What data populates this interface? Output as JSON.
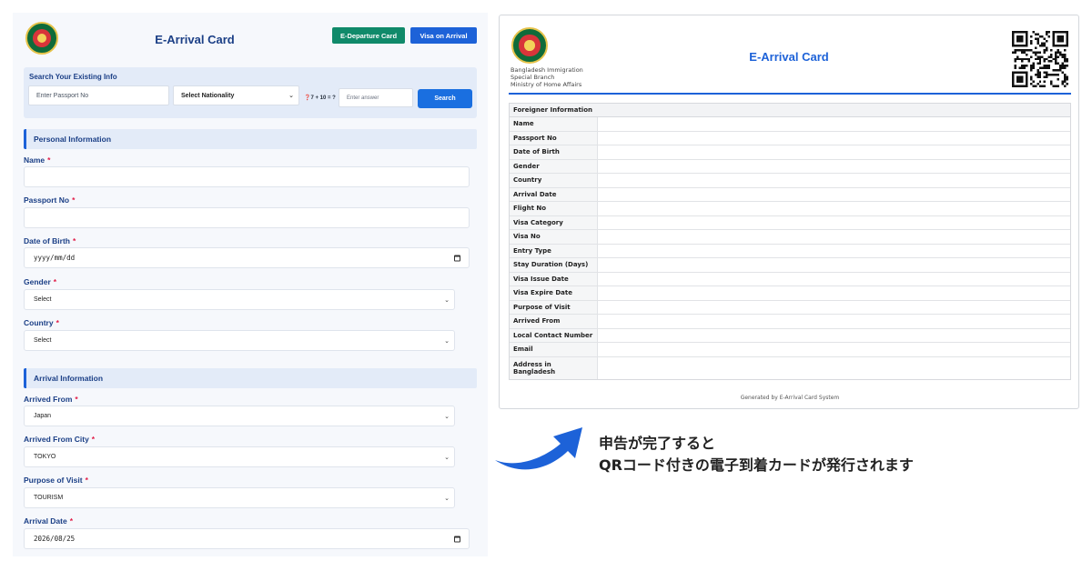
{
  "form": {
    "title": "E-Arrival Card",
    "departure_button": "E-Departure Card",
    "visa_button": "Visa on Arrival",
    "search": {
      "title": "Search Your Existing Info",
      "passport_placeholder": "Enter Passport No",
      "nationality_value": "Select Nationality",
      "captcha_question": "7 + 10 = ?",
      "answer_placeholder": "Enter answer",
      "search_button": "Search"
    },
    "personal_section": "Personal Information",
    "arrival_section": "Arrival Information",
    "required_mark": "*",
    "fields": {
      "name_label": "Name",
      "passport_label": "Passport No",
      "dob_label": "Date of Birth",
      "dob_value": "yyyy/mm/dd",
      "gender_label": "Gender",
      "gender_value": "Select",
      "country_label": "Country",
      "country_value": "Select",
      "arrived_from_label": "Arrived From",
      "arrived_from_value": "Japan",
      "arrived_city_label": "Arrived From City",
      "arrived_city_value": "TOKYO",
      "purpose_label": "Purpose of Visit",
      "purpose_value": "TOURISM",
      "arrival_date_label": "Arrival Date",
      "arrival_date_value": "2026/08/25"
    }
  },
  "card": {
    "org_lines": [
      "Bangladesh Immigration",
      "Special Branch",
      "Ministry of Home Affairs"
    ],
    "title": "E-Arrival Card",
    "table_header": "Foreigner Information",
    "rows": [
      "Name",
      "Passport No",
      "Date of Birth",
      "Gender",
      "Country",
      "Arrival Date",
      "Flight No",
      "Visa Category",
      "Visa No",
      "Entry Type",
      "Stay Duration (Days)",
      "Visa Issue Date",
      "Visa Expire Date",
      "Purpose of Visit",
      "Arrived From",
      "Local Contact Number",
      "Email",
      "Address in Bangladesh"
    ],
    "footer": "Generated by E-Arrival Card System"
  },
  "caption": {
    "line1": "申告が完了すると",
    "line2": "QRコード付きの電子到着カードが発行されます"
  },
  "colors": {
    "primary": "#1d62d8",
    "navy": "#1b3f86",
    "green": "#108a6a",
    "required": "#e11d48"
  }
}
